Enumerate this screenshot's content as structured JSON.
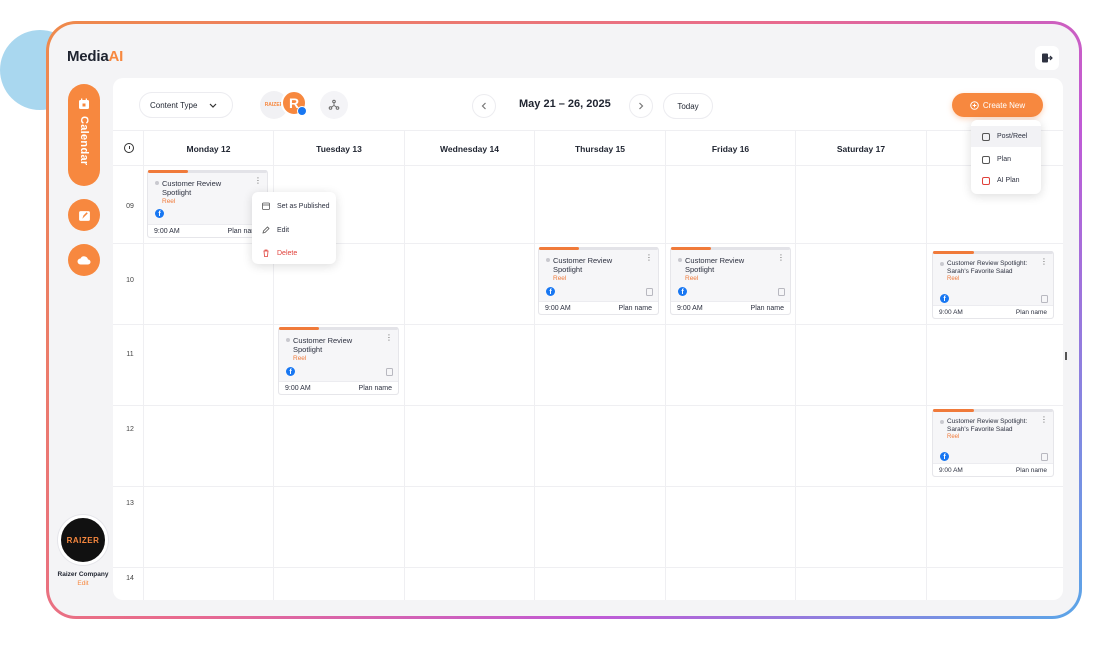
{
  "brand": {
    "name_a": "Media",
    "name_b": "AI"
  },
  "sidebar": {
    "calendar_label": "Calendar",
    "company_name": "Raizer Company",
    "company_edit": "Edit",
    "company_avatar_text": "RAIZER"
  },
  "toolbar": {
    "content_type": "Content Type",
    "account_badge": "RAIZER",
    "account_initial": "R",
    "date_range": "May 21 – 26, 2025",
    "today": "Today",
    "create_new": "Create New"
  },
  "create_menu": [
    {
      "label": "Post/Reel",
      "icon": "edit-square-icon"
    },
    {
      "label": "Plan",
      "icon": "calendar-icon"
    },
    {
      "label": "AI Plan",
      "icon": "ai-calendar-icon"
    }
  ],
  "days": [
    "Monday 12",
    "Tuesday 13",
    "Wednesday 14",
    "Thursday 15",
    "Friday 16",
    "Saturday 17",
    ""
  ],
  "hours": [
    "09",
    "10",
    "11",
    "12",
    "13",
    "14"
  ],
  "cards": [
    {
      "title": "Customer Review Spotlight",
      "type": "Reel",
      "time": "9:00 AM",
      "plan": "Plan name"
    },
    {
      "title": "Customer Review Spotlight",
      "type": "Reel",
      "time": "9:00 AM",
      "plan": "Plan name"
    },
    {
      "title": "Customer Review Spotlight",
      "type": "Reel",
      "time": "9:00 AM",
      "plan": "Plan name"
    },
    {
      "title": "Customer Review Spotlight",
      "type": "Reel",
      "time": "9:00 AM",
      "plan": "Plan name"
    },
    {
      "title": "Customer Review Spotlight: Sarah's Favorite Salad",
      "type": "Reel",
      "time": "9:00 AM",
      "plan": "Plan name"
    },
    {
      "title": "Customer Review Spotlight: Sarah's Favorite Salad",
      "type": "Reel",
      "time": "9:00 AM",
      "plan": "Plan name"
    }
  ],
  "card_menu": {
    "set_published": "Set as Published",
    "edit": "Edit",
    "delete": "Delete"
  },
  "colors": {
    "accent": "#f7883f",
    "facebook": "#1877f2",
    "danger": "#e0403a"
  }
}
